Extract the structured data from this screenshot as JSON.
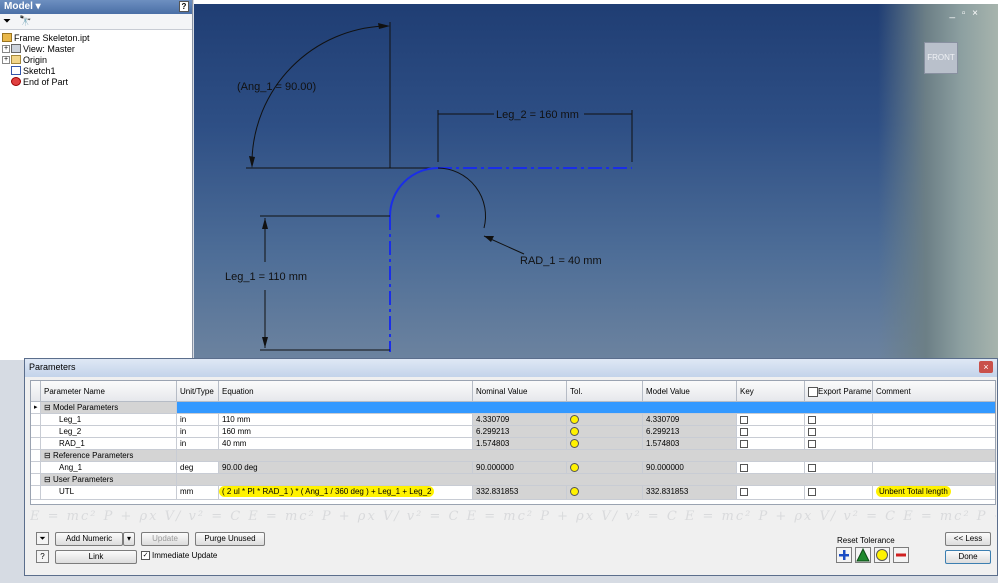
{
  "browser": {
    "title": "Model",
    "help": "?",
    "tree": [
      {
        "label": "Frame Skeleton.ipt",
        "icon": "part-icon"
      },
      {
        "label": "View: Master",
        "icon": "view-icon"
      },
      {
        "label": "Origin",
        "icon": "folder-icon"
      },
      {
        "label": "Sketch1",
        "icon": "sketch-icon"
      },
      {
        "label": "End of Part",
        "icon": "end-of-part-icon"
      }
    ]
  },
  "viewport": {
    "viewcube_label": "FRONT",
    "window_controls": "_ ▫ ×",
    "dimensions": {
      "ang1": "(Ang_1 = 90.00)",
      "leg2": "Leg_2 = 160 mm",
      "leg1": "Leg_1 = 110 mm",
      "rad1": "RAD_1 = 40 mm"
    }
  },
  "params": {
    "title": "Parameters",
    "close": "×",
    "columns": [
      "Parameter Name",
      "Unit/Type",
      "Equation",
      "Nominal Value",
      "Tol.",
      "Model Value",
      "Key",
      "Export Parame",
      "Comment"
    ],
    "groups": {
      "model": "Model Parameters",
      "reference": "Reference Parameters",
      "user": "User Parameters"
    },
    "rows": [
      {
        "name": "Leg_1",
        "unit": "in",
        "equation": "110 mm",
        "nominal": "4.330709",
        "model": "4.330709",
        "comment": ""
      },
      {
        "name": "Leg_2",
        "unit": "in",
        "equation": "160 mm",
        "nominal": "6.299213",
        "model": "6.299213",
        "comment": ""
      },
      {
        "name": "RAD_1",
        "unit": "in",
        "equation": "40 mm",
        "nominal": "1.574803",
        "model": "1.574803",
        "comment": ""
      },
      {
        "name": "Ang_1",
        "unit": "deg",
        "equation": "90.00 deg",
        "nominal": "90.000000",
        "model": "90.000000",
        "comment": ""
      },
      {
        "name": "UTL",
        "unit": "mm",
        "equation": "( 2 ul * PI * RAD_1 ) * ( Ang_1 / 360 deg ) + Leg_1 + Leg_2",
        "nominal": "332.831853",
        "model": "332.831853",
        "comment": "Unbent Total length"
      }
    ],
    "watermark": "E = mc²    P + ρx V/ v² = C    E = mc²    P + ρx V/ v² = C    E = mc²    P + ρx V/ v² = C    E = mc²    P + ρx V/ v² = C    E = mc²    P + ρx V/ v² = C",
    "buttons": {
      "add_numeric": "Add Numeric",
      "update": "Update",
      "purge_unused": "Purge Unused",
      "link": "Link",
      "immediate_update": "Immediate Update",
      "reset_tolerance": "Reset Tolerance",
      "less": "<< Less",
      "done": "Done"
    }
  },
  "colors": {
    "tolerance_yellow": "#fff200",
    "selection_blue": "#3399ff",
    "sketch_blue": "#1a2ee8"
  }
}
